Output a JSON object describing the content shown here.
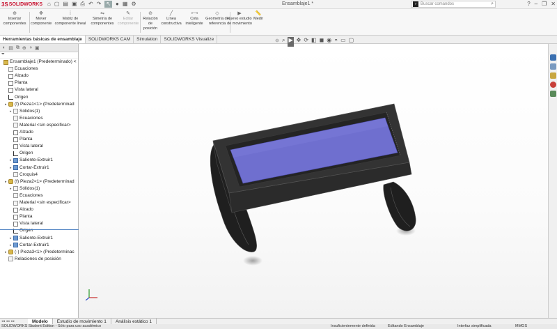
{
  "app": {
    "brand": "SOLIDWORKS",
    "document_title": "Ensamblaje1 *"
  },
  "search": {
    "placeholder": "Buscar comandos"
  },
  "ribbon": {
    "buttons": [
      {
        "label": "Insertar componentes",
        "icon": "insert-components-icon"
      },
      {
        "label": "Mover componente",
        "icon": "move-component-icon"
      },
      {
        "label": "Matriz de componente lineal",
        "icon": "linear-pattern-icon"
      },
      {
        "label": "Simetría de componentes",
        "icon": "mirror-components-icon"
      },
      {
        "label": "Editar componente",
        "icon": "edit-component-icon"
      },
      {
        "label": "Relación de posición",
        "icon": "mate-icon"
      },
      {
        "label": "Línea constructiva",
        "icon": "construction-line-icon"
      },
      {
        "label": "Cota inteligente",
        "icon": "smart-dimension-icon"
      },
      {
        "label": "Geometría de referencia",
        "icon": "reference-geometry-icon"
      },
      {
        "label": "Nuevo estudio de movimiento",
        "icon": "motion-study-icon"
      },
      {
        "label": "Medir",
        "icon": "measure-icon"
      }
    ]
  },
  "tabs": [
    "Herramientas básicas de ensamblaje",
    "SOLIDWORKS CAM",
    "Simulation",
    "SOLIDWORKS Visualize"
  ],
  "tree": {
    "items": [
      {
        "label": "Ensamblaje1  (Predeterminado) <",
        "type": "asm",
        "level": 0
      },
      {
        "label": "Ecuaciones",
        "type": "plain",
        "level": 1
      },
      {
        "label": "Alzado",
        "type": "plane",
        "level": 1
      },
      {
        "label": "Planta",
        "type": "plane",
        "level": 1
      },
      {
        "label": "Vista lateral",
        "type": "plane",
        "level": 1
      },
      {
        "label": "Origen",
        "type": "orig",
        "level": 1
      },
      {
        "label": "(f) Pieza1<1> (Predeterminad",
        "type": "part",
        "level": 1,
        "arrow": true
      },
      {
        "label": "Sólidos(1)",
        "type": "plain",
        "level": 2,
        "arrow": true
      },
      {
        "label": "Ecuaciones",
        "type": "plain",
        "level": 2
      },
      {
        "label": "Material <sin especificar>",
        "type": "plain",
        "level": 2
      },
      {
        "label": "Alzado",
        "type": "plane",
        "level": 2
      },
      {
        "label": "Planta",
        "type": "plane",
        "level": 2
      },
      {
        "label": "Vista lateral",
        "type": "plane",
        "level": 2
      },
      {
        "label": "Origen",
        "type": "orig",
        "level": 2
      },
      {
        "label": "Saliente-Extruir1",
        "type": "feat",
        "level": 2,
        "arrow": true
      },
      {
        "label": "Cortar-Extruir1",
        "type": "feat",
        "level": 2,
        "arrow": true
      },
      {
        "label": "Croquis4",
        "type": "plain",
        "level": 2
      },
      {
        "label": "(f) Pieza2<1> (Predeterminad",
        "type": "part",
        "level": 1,
        "arrow": true
      },
      {
        "label": "Sólidos(1)",
        "type": "plain",
        "level": 2,
        "arrow": true
      },
      {
        "label": "Ecuaciones",
        "type": "plain",
        "level": 2
      },
      {
        "label": "Material <sin especificar>",
        "type": "plain",
        "level": 2
      },
      {
        "label": "Alzado",
        "type": "plane",
        "level": 2
      },
      {
        "label": "Planta",
        "type": "plane",
        "level": 2
      },
      {
        "label": "Vista lateral",
        "type": "plane",
        "level": 2
      },
      {
        "label": "Origen",
        "type": "orig",
        "level": 2
      },
      {
        "label": "Saliente-Extruir1",
        "type": "feat",
        "level": 2,
        "arrow": true
      },
      {
        "label": "Cortar-Extruir1",
        "type": "feat",
        "level": 2,
        "arrow": true
      },
      {
        "label": "(-) Pieza3<1> (Predeterminac",
        "type": "part",
        "level": 1,
        "arrow": true
      },
      {
        "label": "Relaciones de posición",
        "type": "plain",
        "level": 1
      }
    ]
  },
  "bottom_tabs": [
    "Modelo",
    "Estudio de movimiento 1",
    "Análisis estático 1"
  ],
  "status": {
    "edition": "SOLIDWORKS Student Edition - Sólo para uso académico",
    "definition": "Insuficientemente definida",
    "mode": "Editando Ensamblaje",
    "interface": "Interfaz simplificada",
    "units": "MMGS"
  },
  "colors": {
    "brand": "#c8102e",
    "screen_fill": "#6f6fcf",
    "body_fill": "#262626"
  }
}
